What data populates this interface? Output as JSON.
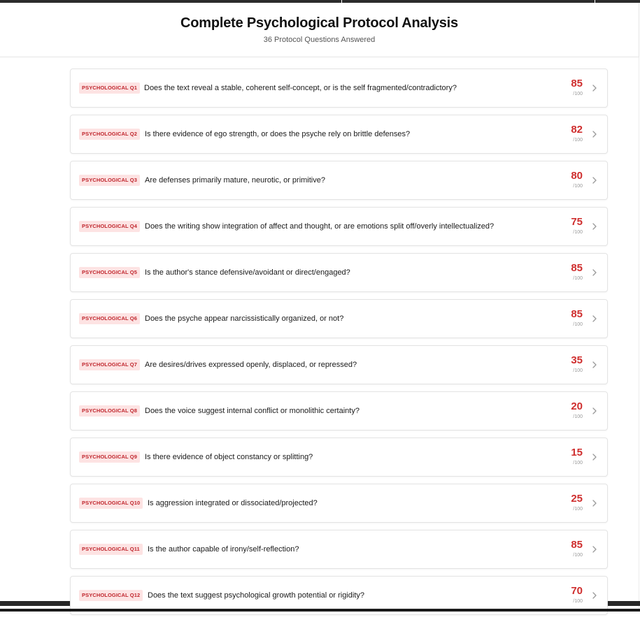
{
  "header": {
    "title": "Complete Psychological Protocol Analysis",
    "subtitle": "36 Protocol Questions Answered"
  },
  "colors": {
    "accent": "#cf2e2e",
    "tag_background": "#fde3e3",
    "tag_text": "#c0262d"
  },
  "icons": {
    "row_action": "chevron-right-icon"
  },
  "items": [
    {
      "tag": "PSYCHOLOGICAL Q1",
      "question": "Does the text reveal a stable, coherent self-concept, or is the self fragmented/contradictory?",
      "score": "85",
      "max": "/100"
    },
    {
      "tag": "PSYCHOLOGICAL Q2",
      "question": "Is there evidence of ego strength, or does the psyche rely on brittle defenses?",
      "score": "82",
      "max": "/100"
    },
    {
      "tag": "PSYCHOLOGICAL Q3",
      "question": "Are defenses primarily mature, neurotic, or primitive?",
      "score": "80",
      "max": "/100"
    },
    {
      "tag": "PSYCHOLOGICAL Q4",
      "question": "Does the writing show integration of affect and thought, or are emotions split off/overly intellectualized?",
      "score": "75",
      "max": "/100"
    },
    {
      "tag": "PSYCHOLOGICAL Q5",
      "question": "Is the author's stance defensive/avoidant or direct/engaged?",
      "score": "85",
      "max": "/100"
    },
    {
      "tag": "PSYCHOLOGICAL Q6",
      "question": "Does the psyche appear narcissistically organized, or not?",
      "score": "85",
      "max": "/100"
    },
    {
      "tag": "PSYCHOLOGICAL Q7",
      "question": "Are desires/drives expressed openly, displaced, or repressed?",
      "score": "35",
      "max": "/100"
    },
    {
      "tag": "PSYCHOLOGICAL Q8",
      "question": "Does the voice suggest internal conflict or monolithic certainty?",
      "score": "20",
      "max": "/100"
    },
    {
      "tag": "PSYCHOLOGICAL Q9",
      "question": "Is there evidence of object constancy or splitting?",
      "score": "15",
      "max": "/100"
    },
    {
      "tag": "PSYCHOLOGICAL Q10",
      "question": "Is aggression integrated or dissociated/projected?",
      "score": "25",
      "max": "/100"
    },
    {
      "tag": "PSYCHOLOGICAL Q11",
      "question": "Is the author capable of irony/self-reflection?",
      "score": "85",
      "max": "/100"
    },
    {
      "tag": "PSYCHOLOGICAL Q12",
      "question": "Does the text suggest psychological growth potential or rigidity?",
      "score": "70",
      "max": "/100"
    }
  ]
}
